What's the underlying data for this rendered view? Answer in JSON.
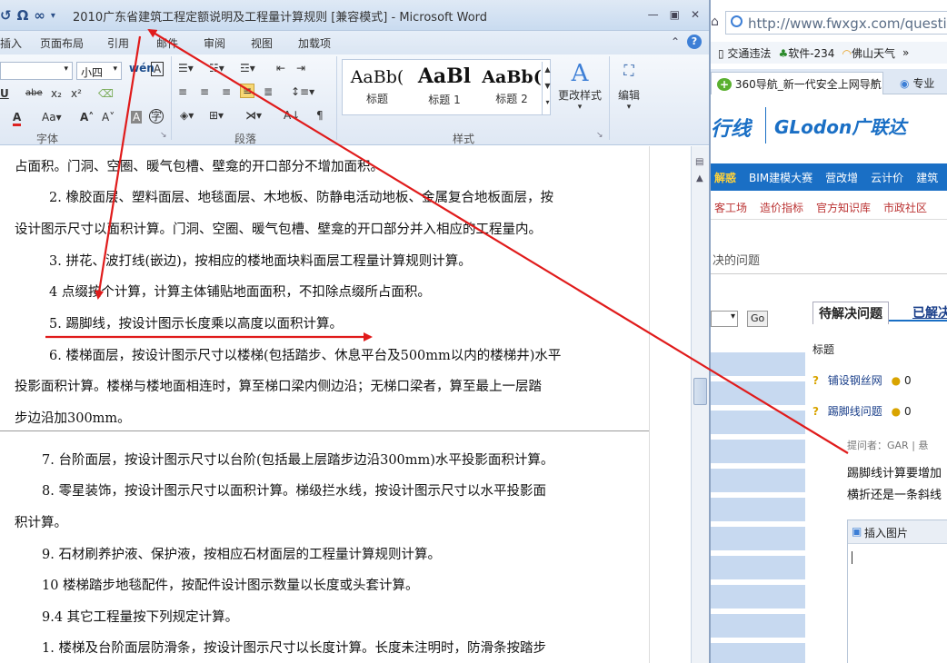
{
  "word": {
    "window_title": "2010广东省建筑工程定额说明及工程量计算规则 [兼容模式] - Microsoft Word",
    "qat_icons": [
      "undo-icon",
      "omega-icon",
      "infinity-icon",
      "customize-icon"
    ],
    "qat_glyphs": [
      "↺",
      "Ω",
      "∞"
    ],
    "tabs": [
      "插入",
      "页面布局",
      "引用",
      "邮件",
      "审阅",
      "视图",
      "加载项"
    ],
    "font_size": "小四",
    "groups": {
      "font": "字体",
      "paragraph": "段落",
      "styles": "样式"
    },
    "font_buttons": [
      "U",
      "abe",
      "x₂",
      "x²",
      "A",
      "Aa",
      "A↑",
      "A↓",
      "wén",
      "A"
    ],
    "styles": [
      {
        "sample": "AaBb(",
        "name": "标题"
      },
      {
        "sample": "AaBl",
        "name": "标题 1"
      },
      {
        "sample": "AaBb(",
        "name": "标题 2"
      }
    ],
    "change_styles": "更改样式",
    "edit": "编辑"
  },
  "document": {
    "page1": [
      "占面积。门洞、空圈、暖气包槽、壁龛的开口部分不增加面积。",
      "2. 橡胶面层、塑料面层、地毯面层、木地板、防静电活动地板、金属复合地板面层，按",
      "设计图示尺寸以面积计算。门洞、空圈、暖气包槽、壁龛的开口部分并入相应的工程量内。",
      "3. 拼花、波打线(嵌边)，按相应的楼地面块料面层工程量计算规则计算。",
      "4 点缀按个计算，计算主体铺贴地面面积，不扣除点缀所占面积。",
      "5. 踢脚线，按设计图示长度乘以高度以面积计算。",
      "6. 楼梯面层，按设计图示尺寸以楼梯(包括踏步、休息平台及500mm以内的楼梯井)水平",
      "投影面积计算。楼梯与楼地面相连时，算至梯口梁内侧边沿；无梯口梁者，算至最上一层踏",
      "步边沿加300mm。"
    ],
    "page2": [
      "7. 台阶面层，按设计图示尺寸以台阶(包括最上层踏步边沿300mm)水平投影面积计算。",
      "8. 零星装饰，按设计图示尺寸以面积计算。梯级拦水线，按设计图示尺寸以水平投影面",
      "积计算。",
      "9. 石材刷养护液、保护液，按相应石材面层的工程量计算规则计算。",
      "10 楼梯踏步地毯配件，按配件设计图示数量以长度或头套计算。",
      "9.4 其它工程量按下列规定计算。",
      "1. 楼梯及台阶面层防滑条，按设计图示尺寸以长度计算。长度未注明时，防滑条按踏步"
    ]
  },
  "browser": {
    "url": "http://www.fwxgx.com/question/",
    "bookmarks": [
      "交通违法",
      "软件-234",
      "佛山天气",
      "»"
    ],
    "tabs": [
      "360导航_新一代安全上网导航",
      "专业"
    ],
    "brand_left": "行线",
    "brand_right": "GLodon广联达",
    "nav": [
      "解惑",
      "BIM建模大赛",
      "营改增",
      "云计价",
      "建筑"
    ],
    "subnav": [
      "客工场",
      "造价指标",
      "官方知识库",
      "市政社区"
    ],
    "search_placeholder": "决的问题",
    "go_label": "Go",
    "right_tabs": [
      "待解决问题",
      "已解决"
    ],
    "col_header": "标题",
    "questions": [
      {
        "title": "铺设钢丝网",
        "score": "0"
      },
      {
        "title": "踢脚线问题",
        "score": "0"
      }
    ],
    "asker_label": "提问者：GAR  |  悬",
    "question_body_1": "踢脚线计算要增加",
    "question_body_2": "横折还是一条斜线",
    "insert_image": "插入图片"
  },
  "colors": {
    "arrow": "#e01b1b",
    "brand_blue": "#1a6fc5",
    "qbg": "#c7d9f0"
  }
}
